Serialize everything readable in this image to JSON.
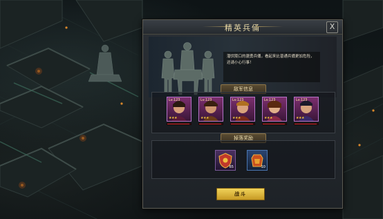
{
  "dialog": {
    "title": "精英兵俑",
    "close_label": "X",
    "intro_text": "潜伏陵口的骁勇兵俑，看起来比普通兵俑更加危险，还请小心行事！",
    "enemy_section_title": "敌军信息",
    "reward_section_title": "掉落奖励",
    "battle_button_label": "战斗"
  },
  "enemies": [
    {
      "level": "Lv.123",
      "stars": 3,
      "hp_fraction": 0.95,
      "name_icon": "general-portrait-1"
    },
    {
      "level": "Lv.123",
      "stars": 3,
      "hp_fraction": 0.95,
      "name_icon": "general-portrait-2"
    },
    {
      "level": "Lv.123",
      "stars": 3,
      "hp_fraction": 0.95,
      "name_icon": "general-portrait-3"
    },
    {
      "level": "Lv.123",
      "stars": 3,
      "hp_fraction": 0.95,
      "name_icon": "general-portrait-4"
    },
    {
      "level": "Lv.123",
      "stars": 3,
      "hp_fraction": 0.95,
      "name_icon": "general-portrait-5"
    }
  ],
  "rewards": [
    {
      "icon": "shield-emblem-icon",
      "quantity": "65",
      "rarity_color": "#7a5a9a"
    },
    {
      "icon": "badge-pouch-icon",
      "quantity": "10",
      "rarity_color": "#4a76b0"
    }
  ],
  "colors": {
    "accent_gold": "#e6d7a6",
    "battle_button": "#e2c04a",
    "portrait_frame": "#b474c8",
    "hp_bar": "#d23030"
  }
}
